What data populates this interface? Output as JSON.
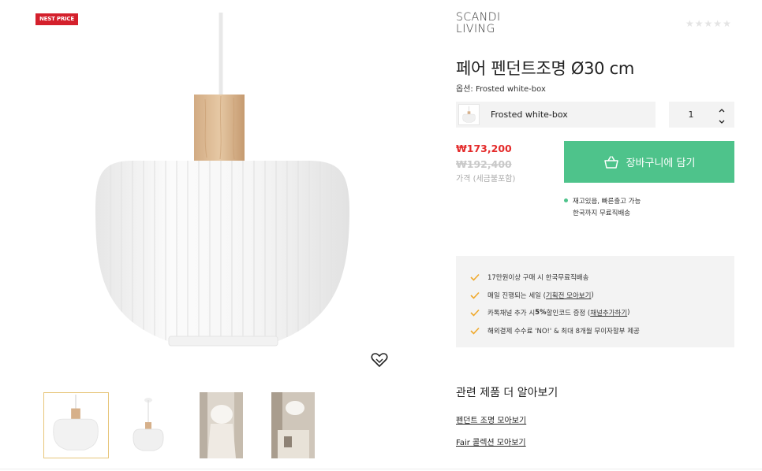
{
  "badge": "NEST PRICE",
  "brand": {
    "line1": "SCANDI",
    "line2": "LIVING"
  },
  "rating": {
    "stars": 5,
    "filled": 0
  },
  "product": {
    "title": "페어 펜던트조명 Ø30 cm",
    "option_prefix": "옵션:",
    "option_value": "Frosted white-box"
  },
  "option_select": {
    "label": "Frosted white-box"
  },
  "quantity": {
    "value": "1"
  },
  "price": {
    "sale": "₩173,200",
    "original": "₩192,400",
    "note": "가격 (세금불포함)"
  },
  "cart": {
    "label": "장바구니에 담기"
  },
  "stock": {
    "line1": "재고있음, 빠른출고 가능",
    "line2": "한국까지 무료직배송"
  },
  "benefits": {
    "b1": {
      "text": "17만원이상 구매 시 한국무료직배송"
    },
    "b2": {
      "pre": "매일 진행되는 세일 (",
      "link": "기획전 모아보기",
      "post": ")"
    },
    "b3": {
      "pre": "카톡채널 추가 시 ",
      "bold": "5%",
      "mid": " 할인코드 증정 (",
      "link": "채널추가하기",
      "post": ")"
    },
    "b4": {
      "text": "해외결제 수수료 'NO!' & 최대 8개월 무이자할부 제공"
    }
  },
  "related": {
    "title": "관련 제품 더 알아보기",
    "links": [
      "펜던트 조명 모아보기",
      "Fair 콜렉션 모아보기"
    ]
  },
  "colors": {
    "accent_green": "#4ec38b",
    "sale_red": "#e42b2b",
    "badge_red": "#d4202c",
    "check_orange": "#f0a92c"
  },
  "icons": [
    "heart-icon",
    "basket-icon",
    "chevron-up-icon",
    "chevron-down-icon",
    "check-icon",
    "star-icon"
  ]
}
